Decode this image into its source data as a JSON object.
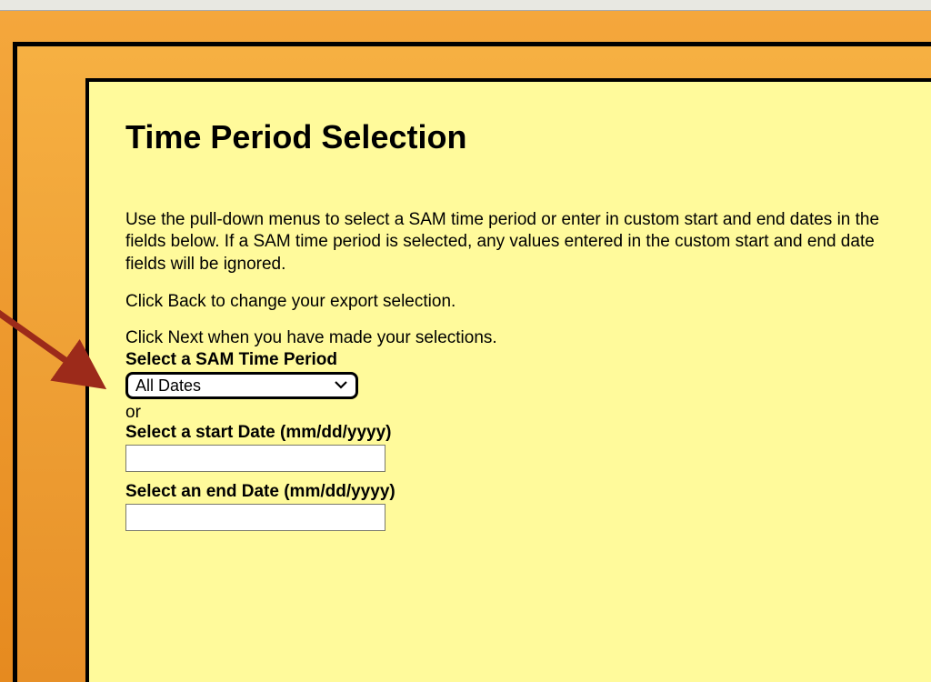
{
  "page": {
    "title": "Time Period Selection"
  },
  "instructions": {
    "p1": "Use the pull-down menus to select a SAM time period or enter in custom start and end dates in the fields below. If a SAM time period is selected, any values entered in the custom start and end date fields will be ignored.",
    "p2": "Click Back to change your export selection.",
    "p3": "Click Next when you have made your selections."
  },
  "form": {
    "sam_period_label": "Select a SAM Time Period",
    "sam_period_value": "All Dates",
    "sam_period_options": [
      "All Dates"
    ],
    "or_text": "or",
    "start_date_label": "Select a start Date (mm/dd/yyyy)",
    "start_date_value": "",
    "end_date_label": "Select an end Date (mm/dd/yyyy)",
    "end_date_value": ""
  },
  "colors": {
    "outer_orange": "#f2a63a",
    "panel_yellow": "#fffa9b",
    "annotation_red": "#9c2a1a"
  }
}
